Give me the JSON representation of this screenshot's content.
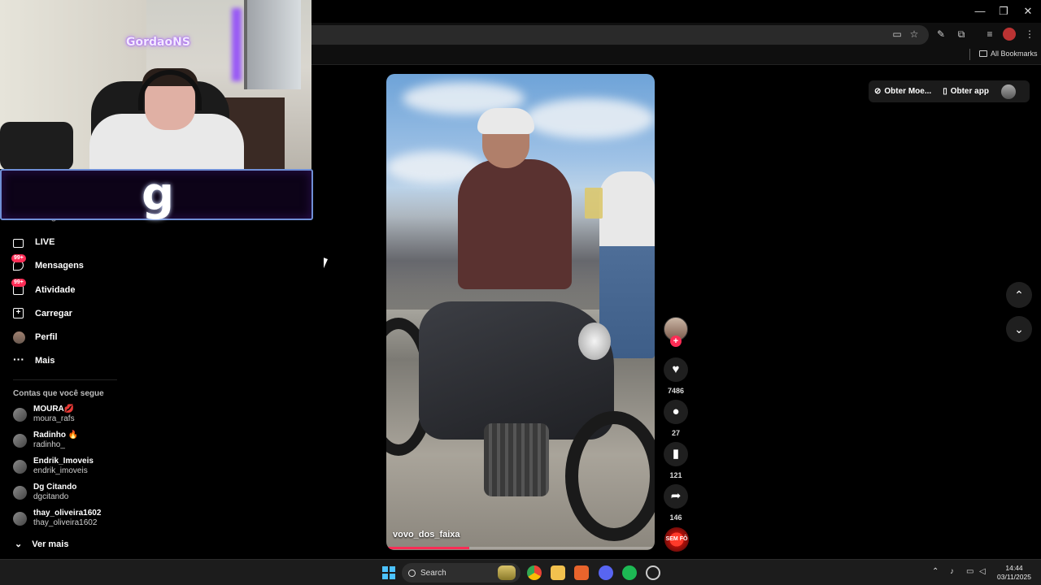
{
  "browser": {
    "bookmarks_folder": "All Bookmarks",
    "icons": [
      "install-icon",
      "star-icon",
      "extension-icon",
      "puzzle-icon",
      "media-icon",
      "profile-icon",
      "menu-icon"
    ]
  },
  "stream": {
    "streamer_name": "GordaoNS",
    "logo_letter": "g"
  },
  "sidebar": {
    "partial_item": "Amigos",
    "items": [
      {
        "label": "LIVE",
        "icon": "live-tv-icon"
      },
      {
        "label": "Mensagens",
        "icon": "messages-icon",
        "badge": "99+"
      },
      {
        "label": "Atividade",
        "icon": "activity-icon",
        "badge": "99+"
      },
      {
        "label": "Carregar",
        "icon": "upload-icon"
      },
      {
        "label": "Perfil",
        "icon": "profile-avatar-icon"
      },
      {
        "label": "Mais",
        "icon": "more-dots-icon"
      }
    ],
    "following_title": "Contas que você segue",
    "accounts": [
      {
        "name": "MOURA💋",
        "handle": "moura_rafs"
      },
      {
        "name": "Radinho 🔥",
        "handle": "radinho_"
      },
      {
        "name": "Endrik_Imoveis",
        "handle": "endrik_imoveis"
      },
      {
        "name": "Dg Citando",
        "handle": "dgcitando"
      },
      {
        "name": "thay_oliveira1602",
        "handle": "thay_oliveira1602"
      }
    ],
    "see_more": "Ver mais"
  },
  "top_actions": {
    "coins": "Obter Moe...",
    "app": "Obter app"
  },
  "video": {
    "caption": "vovo_dos_faixa",
    "progress": 0.31,
    "likes": "7486",
    "comments": "27",
    "saves": "121",
    "shares": "146",
    "music_label": "SEM FÔ"
  },
  "taskbar": {
    "search_placeholder": "Search",
    "time": "14:44",
    "date": "03/11/2025"
  },
  "colors": {
    "accent": "#fe2c55",
    "background": "#000000",
    "windows_blue": "#4cc2ff"
  }
}
